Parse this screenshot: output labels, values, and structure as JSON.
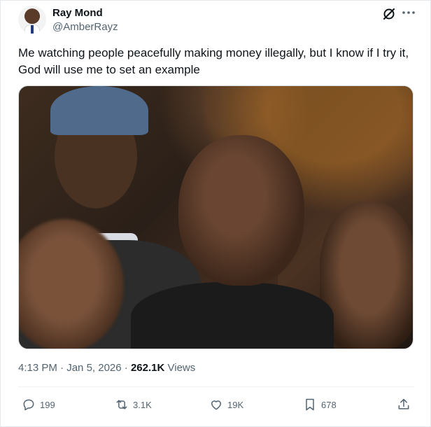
{
  "author": {
    "name": "Ray Mond",
    "handle": "@AmberRayz"
  },
  "tweet": {
    "text": "Me watching people peacefully making money illegally, but I know if I try it, God will use me to set an example"
  },
  "meta": {
    "time": "4:13 PM",
    "date": "Jan 5, 2026",
    "separator": "·",
    "views_count": "262.1K",
    "views_label": "Views"
  },
  "actions": {
    "replies": "199",
    "retweets": "3.1K",
    "likes": "19K",
    "bookmarks": "678"
  },
  "icons": {
    "header": [
      "grok-icon",
      "more-icon"
    ],
    "footer": [
      "reply-icon",
      "retweet-icon",
      "like-icon",
      "bookmark-icon",
      "share-icon"
    ]
  },
  "colors": {
    "text": "#0f1419",
    "secondary": "#536471",
    "border": "#e6e9ec"
  }
}
